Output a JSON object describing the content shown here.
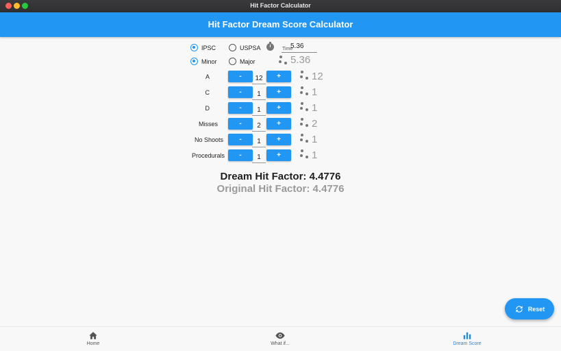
{
  "window": {
    "title": "Hit Factor Calculator"
  },
  "appbar": {
    "title": "Hit Factor Dream Score Calculator"
  },
  "division": [
    {
      "label": "IPSC",
      "selected": true
    },
    {
      "label": "USPSA",
      "selected": false
    }
  ],
  "power_factor": [
    {
      "label": "Minor",
      "selected": true
    },
    {
      "label": "Major",
      "selected": false
    }
  ],
  "time": {
    "label": "Time",
    "value": "5.36",
    "original": "5.36"
  },
  "buttons": {
    "minus": "-",
    "plus": "+"
  },
  "rows": [
    {
      "label": "A",
      "value": "12",
      "original": "12"
    },
    {
      "label": "C",
      "value": "1",
      "original": "1"
    },
    {
      "label": "D",
      "value": "1",
      "original": "1"
    },
    {
      "label": "Misses",
      "value": "2",
      "original": "2"
    },
    {
      "label": "No Shoots",
      "value": "1",
      "original": "1"
    },
    {
      "label": "Procedurals",
      "value": "1",
      "original": "1"
    }
  ],
  "results": {
    "dream": "Dream Hit Factor: 4.4776",
    "original": "Original Hit Factor: 4.4776"
  },
  "fab": {
    "label": "Reset",
    "icon": "refresh-icon"
  },
  "bottom_nav": [
    {
      "label": "Home",
      "icon": "home-icon",
      "active": false
    },
    {
      "label": "What if...",
      "icon": "eye-icon",
      "active": false
    },
    {
      "label": "Dream Score",
      "icon": "bar-chart-icon",
      "active": true
    }
  ],
  "colors": {
    "accent": "#2196f3",
    "active_nav": "#1e88e5"
  }
}
